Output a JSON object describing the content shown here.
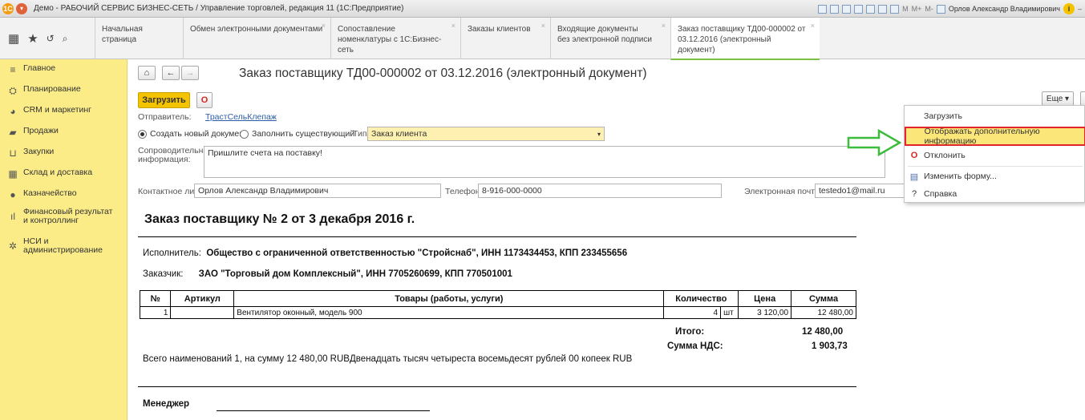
{
  "titlebar": {
    "title": "Демо - РАБОЧИЙ СЕРВИС БИЗНЕС-СЕТЬ / Управление торговлей, редакция 11  (1С:Предприятие)",
    "tools": [
      "M",
      "M+",
      "M-"
    ],
    "user": "Орлов Александр Владимирович"
  },
  "tabs": [
    {
      "label": "Начальная страница"
    },
    {
      "label": "Обмен электронными документами"
    },
    {
      "label": "Сопоставление номенклатуры с 1С:Бизнес-сеть"
    },
    {
      "label": "Заказы клиентов"
    },
    {
      "label": "Входящие документы без электронной подписи"
    },
    {
      "label": "Заказ поставщику ТД00-000002 от 03.12.2016 (электронный документ)"
    }
  ],
  "sidebar": [
    {
      "label": "Главное",
      "icon": "menu-icon"
    },
    {
      "label": "Планирование",
      "icon": "planning-icon"
    },
    {
      "label": "CRM и маркетинг",
      "icon": "crm-icon"
    },
    {
      "label": "Продажи",
      "icon": "sales-icon"
    },
    {
      "label": "Закупки",
      "icon": "cart-icon"
    },
    {
      "label": "Склад и доставка",
      "icon": "warehouse-icon"
    },
    {
      "label": "Казначейство",
      "icon": "treasury-icon"
    },
    {
      "label": "Финансовый результат и контроллинг",
      "icon": "chart-icon"
    },
    {
      "label": "НСИ и администрирование",
      "icon": "gear-icon"
    }
  ],
  "form": {
    "title": "Заказ поставщику ТД00-000002 от 03.12.2016 (электронный документ)",
    "load_button": "Загрузить",
    "more_button": "Еще",
    "sender_label": "Отправитель:",
    "sender_value": "ТрастСельКлепаж",
    "radio_create": "Создать новый документ",
    "radio_fill": "Заполнить существующий",
    "type_label": "Тип:",
    "type_value": "Заказ клиента",
    "info_label": "Сопроводительная информация:",
    "info_value": "Пришлите счета на поставку!",
    "contact_label": "Контактное лицо:",
    "contact_value": "Орлов Александр Владимирович",
    "phone_label": "Телефон:",
    "phone_value": "8-916-000-0000",
    "email_label": "Электронная почта:",
    "email_value": "testedo1@mail.ru"
  },
  "document": {
    "title": "Заказ поставщику № 2 от 3 декабря 2016 г.",
    "executor_label": "Исполнитель:",
    "executor_value": "Общество с ограниченной ответственностью \"Стройснаб\", ИНН 1173434453, КПП 233455656",
    "customer_label": "Заказчик:",
    "customer_value": "ЗАО \"Торговый дом Комплексный\", ИНН 7705260699, КПП 770501001",
    "table_headers": [
      "№",
      "Артикул",
      "Товары (работы, услуги)",
      "Количество",
      "Цена",
      "Сумма"
    ],
    "rows": [
      {
        "num": "1",
        "article": "",
        "name": "Вентилятор оконный, модель 900",
        "qty": "4",
        "unit": "шт",
        "price": "3 120,00",
        "sum": "12 480,00"
      }
    ],
    "total_label": "Итого:",
    "total_value": "12 480,00",
    "vat_label": "Сумма НДС:",
    "vat_value": "1 903,73",
    "summary": "Всего наименований 1, на сумму 12 480,00 RUBДвенадцать тысяч четыреста восемьдесят рублей 00 копеек RUB",
    "manager_label": "Менеджер"
  },
  "menu": [
    {
      "label": "Загрузить",
      "icon": ""
    },
    {
      "label": "Отображать дополнительную информацию",
      "icon": ""
    },
    {
      "label": "Отклонить",
      "icon": "reject-icon"
    },
    {
      "label": "Изменить форму...",
      "icon": "form-icon"
    },
    {
      "label": "Справка",
      "icon": "help-icon"
    }
  ],
  "colors": {
    "accent": "#f4c300",
    "sidebar": "#fbec88",
    "highlight": "#e0262b",
    "arrow": "#3dbb3d"
  }
}
